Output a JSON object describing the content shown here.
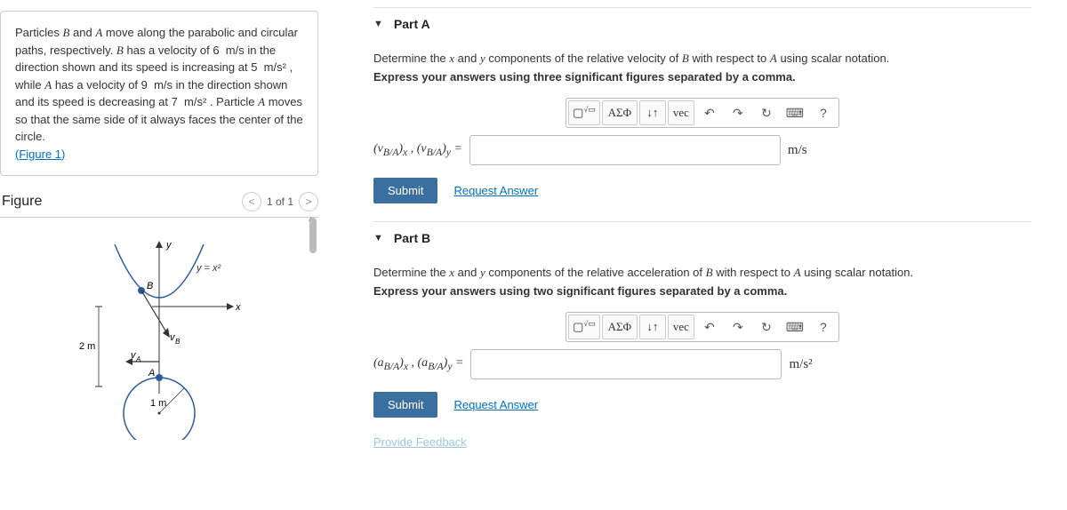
{
  "problem": {
    "text_html": "Particles <span class='var'>B</span> and <span class='var'>A</span> move along the parabolic and circular paths, respectively. <span class='var'>B</span> has a velocity of 6&nbsp; m/s in the direction shown and its speed is increasing at 5&nbsp; m/s² , while <span class='var'>A</span> has a velocity of 9&nbsp; m/s in the direction shown and its speed is decreasing at 7&nbsp; m/s² . Particle <span class='var'>A</span> moves so that the same side of it always faces the center of the circle.",
    "figure_link": "(Figure 1)"
  },
  "figure": {
    "title": "Figure",
    "pager": "1 of 1",
    "labels": {
      "y": "y",
      "x": "x",
      "curve": "y = x²",
      "B": "B",
      "A": "A",
      "vB": "v_B",
      "vA": "v_A",
      "dist_v": "2 m",
      "dist_h": "1 m"
    }
  },
  "parts": [
    {
      "title": "Part A",
      "prompt_html": "Determine the <span class='var'>x</span> and <span class='var'>y</span> components of the relative velocity of <span class='var'>B</span> with respect to <span class='var'>A</span> using scalar notation.",
      "instruction": "Express your answers using three significant figures separated by a comma.",
      "answer_label_html": "(v<sub>B/A</sub>)<sub>x</sub> , (v<sub>B/A</sub>)<sub>y</sub> =",
      "unit_html": "m/s",
      "submit": "Submit",
      "request": "Request Answer"
    },
    {
      "title": "Part B",
      "prompt_html": "Determine the <span class='var'>x</span> and <span class='var'>y</span> components of the relative acceleration of <span class='var'>B</span> with respect to <span class='var'>A</span> using scalar notation.",
      "instruction": "Express your answers using two significant figures separated by a comma.",
      "answer_label_html": "(a<sub>B/A</sub>)<sub>x</sub> , (a<sub>B/A</sub>)<sub>y</sub> =",
      "unit_html": "m/s²",
      "submit": "Submit",
      "request": "Request Answer"
    }
  ],
  "toolbar": {
    "template": "▭√▭",
    "greek": "ΑΣΦ",
    "subsup": "↓↑",
    "vec": "vec",
    "undo": "↶",
    "redo": "↷",
    "reset": "↻",
    "keyboard": "⌨",
    "help": "?"
  },
  "feedback": "Provide Feedback"
}
